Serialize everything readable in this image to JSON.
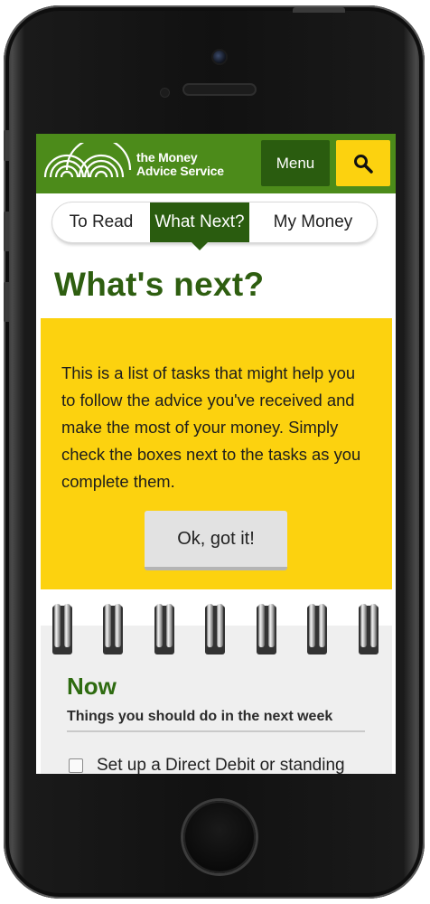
{
  "header": {
    "logo_line1": "the Money",
    "logo_line2": "Advice Service",
    "menu_label": "Menu",
    "search_icon": "search-icon"
  },
  "tabs": [
    {
      "label": "To Read",
      "active": false
    },
    {
      "label": "What Next?",
      "active": true
    },
    {
      "label": "My Money",
      "active": false
    }
  ],
  "page_title": "What's next?",
  "notice": {
    "text": "This is a list of tasks that might help you to follow the advice you've received and make the most of your money. Simply check the boxes next to the tasks as you complete them.",
    "button_label": "Ok, got it!"
  },
  "section": {
    "heading": "Now",
    "subheading": "Things you should do in the next week",
    "tasks": [
      {
        "label": "Set up a Direct Debit or standing",
        "checked": false
      }
    ]
  },
  "colors": {
    "brand_green": "#4c8b1a",
    "dark_green": "#2a5c0f",
    "title_green": "#2e5e10",
    "accent_yellow": "#fcd20f"
  }
}
